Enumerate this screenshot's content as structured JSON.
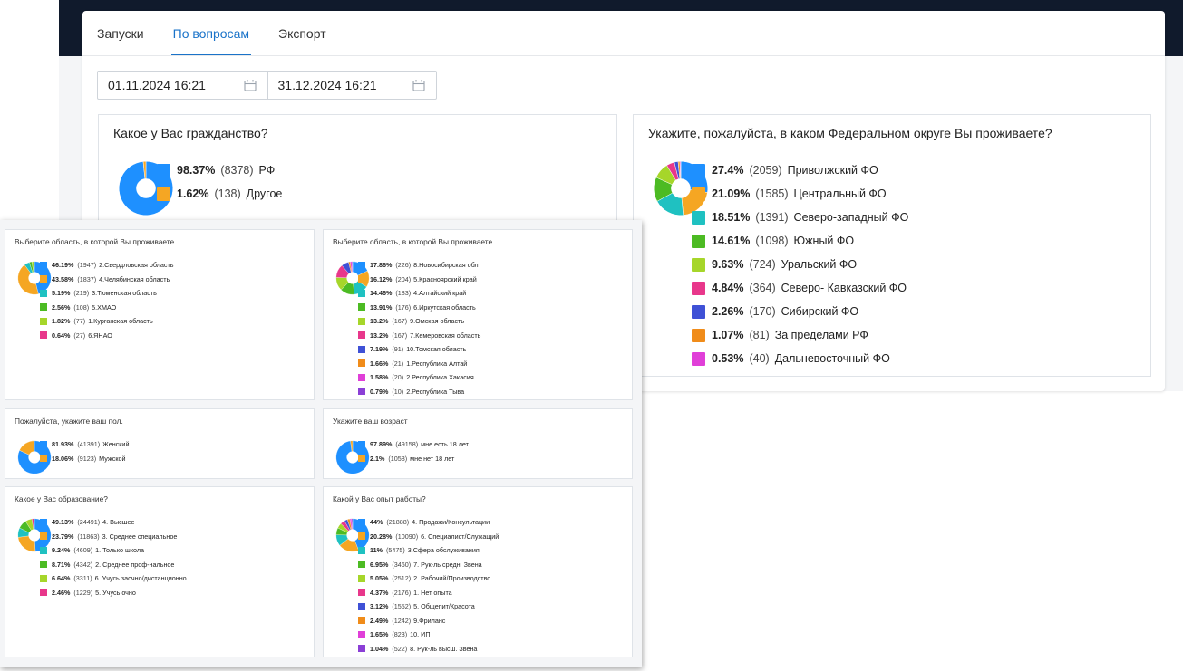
{
  "tabs": [
    "Запуски",
    "По вопросам",
    "Экспорт"
  ],
  "active_tab": 1,
  "date_range": {
    "from": "01.11.2024 16:21",
    "to": "31.12.2024 16:21"
  },
  "icons": {
    "calendar": "calendar-icon"
  },
  "colors": [
    "#1e90ff",
    "#f5a623",
    "#1fc1c1",
    "#4cbb23",
    "#a6d62a",
    "#e8378b",
    "#3f51d6",
    "#f08c1a",
    "#e03fd8",
    "#8b3fd6"
  ],
  "chart_data": [
    {
      "id": "citizenship",
      "type": "pie",
      "title": "Какое у Вас гражданство?",
      "series": [
        {
          "label": "РФ",
          "percent": 98.37,
          "percent_text": "98.37%",
          "count_text": "(8378)"
        },
        {
          "label": "Другое",
          "percent": 1.62,
          "percent_text": "1.62%",
          "count_text": "(138)"
        }
      ]
    },
    {
      "id": "district",
      "type": "pie",
      "title": "Укажите, пожалуйста, в каком Федеральном округе Вы проживаете?",
      "series": [
        {
          "label": "Приволжский ФО",
          "percent": 27.4,
          "percent_text": "27.4%",
          "count_text": "(2059)"
        },
        {
          "label": "Центральный ФО",
          "percent": 21.09,
          "percent_text": "21.09%",
          "count_text": "(1585)"
        },
        {
          "label": "Северо-западный ФО",
          "percent": 18.51,
          "percent_text": "18.51%",
          "count_text": "(1391)"
        },
        {
          "label": "Южный ФО",
          "percent": 14.61,
          "percent_text": "14.61%",
          "count_text": "(1098)"
        },
        {
          "label": "Уральский ФО",
          "percent": 9.63,
          "percent_text": "9.63%",
          "count_text": "(724)"
        },
        {
          "label": "Северо- Кавказский ФО",
          "percent": 4.84,
          "percent_text": "4.84%",
          "count_text": "(364)"
        },
        {
          "label": "Сибирский ФО",
          "percent": 2.26,
          "percent_text": "2.26%",
          "count_text": "(170)"
        },
        {
          "label": "За пределами РФ",
          "percent": 1.07,
          "percent_text": "1.07%",
          "count_text": "(81)"
        },
        {
          "label": "Дальневосточный ФО",
          "percent": 0.53,
          "percent_text": "0.53%",
          "count_text": "(40)"
        }
      ]
    },
    {
      "id": "region-ural",
      "type": "pie",
      "title": "Выберите область, в которой Вы проживаете.",
      "series": [
        {
          "label": "2.Свердловская область",
          "percent": 46.19,
          "percent_text": "46.19%",
          "count_text": "(1947)"
        },
        {
          "label": "4.Челябинская область",
          "percent": 43.58,
          "percent_text": "43.58%",
          "count_text": "(1837)"
        },
        {
          "label": "3.Тюменская область",
          "percent": 5.19,
          "percent_text": "5.19%",
          "count_text": "(219)"
        },
        {
          "label": "5.ХМАО",
          "percent": 2.56,
          "percent_text": "2.56%",
          "count_text": "(108)"
        },
        {
          "label": "1.Курганская область",
          "percent": 1.82,
          "percent_text": "1.82%",
          "count_text": "(77)"
        },
        {
          "label": "6.ЯНАО",
          "percent": 0.64,
          "percent_text": "0.64%",
          "count_text": "(27)"
        }
      ]
    },
    {
      "id": "region-siberia",
      "type": "pie",
      "title": "Выберите область, в которой Вы проживаете.",
      "series": [
        {
          "label": "8.Новосибирская обл",
          "percent": 17.86,
          "percent_text": "17.86%",
          "count_text": "(226)"
        },
        {
          "label": "5.Красноярский край",
          "percent": 16.12,
          "percent_text": "16.12%",
          "count_text": "(204)"
        },
        {
          "label": "4.Алтайский край",
          "percent": 14.46,
          "percent_text": "14.46%",
          "count_text": "(183)"
        },
        {
          "label": "6.Иркутская область",
          "percent": 13.91,
          "percent_text": "13.91%",
          "count_text": "(176)"
        },
        {
          "label": "9.Омская область",
          "percent": 13.2,
          "percent_text": "13.2%",
          "count_text": "(167)"
        },
        {
          "label": "7.Кемеровская область",
          "percent": 13.2,
          "percent_text": "13.2%",
          "count_text": "(167)"
        },
        {
          "label": "10.Томская область",
          "percent": 7.19,
          "percent_text": "7.19%",
          "count_text": "(91)"
        },
        {
          "label": "1.Республика Алтай",
          "percent": 1.66,
          "percent_text": "1.66%",
          "count_text": "(21)"
        },
        {
          "label": "2.Республика Хакасия",
          "percent": 1.58,
          "percent_text": "1.58%",
          "count_text": "(20)"
        },
        {
          "label": "2.Республика Тыва",
          "percent": 0.79,
          "percent_text": "0.79%",
          "count_text": "(10)"
        }
      ]
    },
    {
      "id": "gender",
      "type": "pie",
      "title": "Пожалуйста, укажите ваш пол.",
      "series": [
        {
          "label": "Женский",
          "percent": 81.93,
          "percent_text": "81.93%",
          "count_text": "(41391)"
        },
        {
          "label": "Мужской",
          "percent": 18.06,
          "percent_text": "18.06%",
          "count_text": "(9123)"
        }
      ]
    },
    {
      "id": "age",
      "type": "pie",
      "title": "Укажите ваш возраст",
      "series": [
        {
          "label": "мне есть 18 лет",
          "percent": 97.89,
          "percent_text": "97.89%",
          "count_text": "(49158)"
        },
        {
          "label": "мне нет 18 лет",
          "percent": 2.1,
          "percent_text": "2.1%",
          "count_text": "(1058)"
        }
      ]
    },
    {
      "id": "education",
      "type": "pie",
      "title": "Какое у Вас образование?",
      "series": [
        {
          "label": "4. Высшее",
          "percent": 49.13,
          "percent_text": "49.13%",
          "count_text": "(24491)"
        },
        {
          "label": "3. Среднее специальное",
          "percent": 23.79,
          "percent_text": "23.79%",
          "count_text": "(11863)"
        },
        {
          "label": "1. Только школа",
          "percent": 9.24,
          "percent_text": "9.24%",
          "count_text": "(4609)"
        },
        {
          "label": "2. Среднее проф-нальное",
          "percent": 8.71,
          "percent_text": "8.71%",
          "count_text": "(4342)"
        },
        {
          "label": "6. Учусь заочно/дистанционно",
          "percent": 6.64,
          "percent_text": "6.64%",
          "count_text": "(3311)"
        },
        {
          "label": "5. Учусь очно",
          "percent": 2.46,
          "percent_text": "2.46%",
          "count_text": "(1229)"
        }
      ]
    },
    {
      "id": "experience",
      "type": "pie",
      "title": "Какой у Вас опыт работы?",
      "series": [
        {
          "label": "4. Продажи/Консультации",
          "percent": 44,
          "percent_text": "44%",
          "count_text": "(21888)"
        },
        {
          "label": "6. Специалист/Служащий",
          "percent": 20.28,
          "percent_text": "20.28%",
          "count_text": "(10090)"
        },
        {
          "label": "3.Сфера обслуживания",
          "percent": 11,
          "percent_text": "11%",
          "count_text": "(5475)"
        },
        {
          "label": "7. Рук-ль средн. Звена",
          "percent": 6.95,
          "percent_text": "6.95%",
          "count_text": "(3460)"
        },
        {
          "label": "2. Рабочий/Производство",
          "percent": 5.05,
          "percent_text": "5.05%",
          "count_text": "(2512)"
        },
        {
          "label": "1. Нет опыта",
          "percent": 4.37,
          "percent_text": "4.37%",
          "count_text": "(2176)"
        },
        {
          "label": "5. Общепит/Красота",
          "percent": 3.12,
          "percent_text": "3.12%",
          "count_text": "(1552)"
        },
        {
          "label": "9.Фриланс",
          "percent": 2.49,
          "percent_text": "2.49%",
          "count_text": "(1242)"
        },
        {
          "label": "10. ИП",
          "percent": 1.65,
          "percent_text": "1.65%",
          "count_text": "(823)"
        },
        {
          "label": "8. Рук-ль высш. Звена",
          "percent": 1.04,
          "percent_text": "1.04%",
          "count_text": "(522)"
        }
      ]
    }
  ]
}
